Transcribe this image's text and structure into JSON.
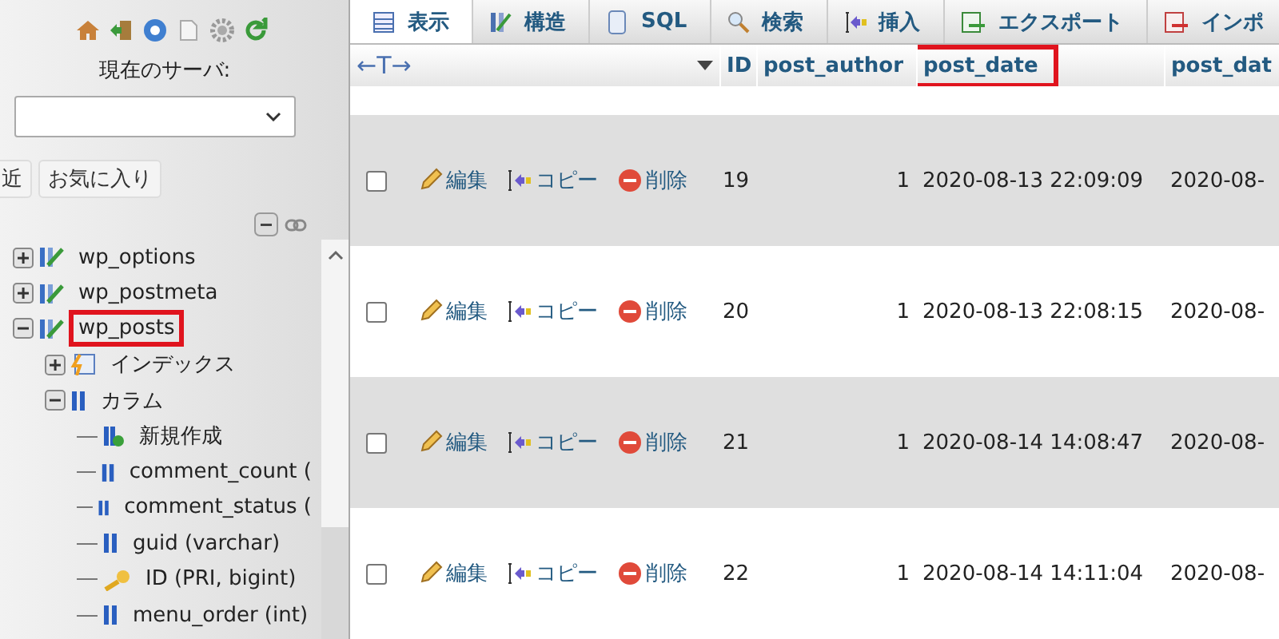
{
  "sidebar": {
    "server_label": "現在のサーバ:",
    "buttons": [
      {
        "label": "近"
      },
      {
        "label": "お気に入り"
      }
    ],
    "tree": [
      {
        "label": "wp_options",
        "kind": "table",
        "expanded": false,
        "highlighted": false
      },
      {
        "label": "wp_postmeta",
        "kind": "table",
        "expanded": false,
        "highlighted": false
      },
      {
        "label": "wp_posts",
        "kind": "table",
        "expanded": true,
        "highlighted": true,
        "children": [
          {
            "label": "インデックス",
            "kind": "index",
            "expanded": false,
            "highlighted": false
          },
          {
            "label": "カラム",
            "kind": "columns",
            "expanded": true,
            "highlighted": false,
            "children": [
              {
                "label": "新規作成",
                "kind": "add",
                "highlighted": false
              },
              {
                "label": "comment_count (",
                "kind": "column",
                "highlighted": false
              },
              {
                "label": "comment_status (",
                "kind": "column",
                "highlighted": false
              },
              {
                "label": "guid (varchar)",
                "kind": "column",
                "highlighted": false
              },
              {
                "label": "ID (PRI, bigint)",
                "kind": "key",
                "highlighted": false
              },
              {
                "label": "menu_order (int)",
                "kind": "column",
                "highlighted": false
              }
            ]
          }
        ]
      }
    ]
  },
  "tabs": [
    {
      "label": "表示",
      "kind": "browse",
      "selected": true
    },
    {
      "label": "構造",
      "kind": "structure",
      "selected": false
    },
    {
      "label": "SQL",
      "kind": "sql",
      "selected": false
    },
    {
      "label": "検索",
      "kind": "search",
      "selected": false
    },
    {
      "label": "挿入",
      "kind": "insert",
      "selected": false
    },
    {
      "label": "エクスポート",
      "kind": "export",
      "selected": false
    },
    {
      "label": "インポ",
      "kind": "import",
      "selected": false
    }
  ],
  "table": {
    "resize_label": "←T→",
    "columns": [
      {
        "label": "ID",
        "highlighted": false
      },
      {
        "label": "post_author",
        "highlighted": false
      },
      {
        "label": "post_date",
        "highlighted": true
      },
      {
        "label": "post_dat",
        "highlighted": false
      }
    ],
    "rows": [
      {
        "checked": false,
        "actions": [
          "編集",
          "コピー",
          "削除"
        ],
        "cells": [
          "19",
          "1",
          "2020-08-13 22:09:09",
          "2020-08-"
        ]
      },
      {
        "checked": false,
        "actions": [
          "編集",
          "コピー",
          "削除"
        ],
        "cells": [
          "20",
          "1",
          "2020-08-13 22:08:15",
          "2020-08-"
        ]
      },
      {
        "checked": false,
        "actions": [
          "編集",
          "コピー",
          "削除"
        ],
        "cells": [
          "21",
          "1",
          "2020-08-14 14:08:47",
          "2020-08-"
        ]
      },
      {
        "checked": false,
        "actions": [
          "編集",
          "コピー",
          "削除"
        ],
        "cells": [
          "22",
          "1",
          "2020-08-14 14:11:04",
          "2020-08-"
        ]
      }
    ]
  }
}
